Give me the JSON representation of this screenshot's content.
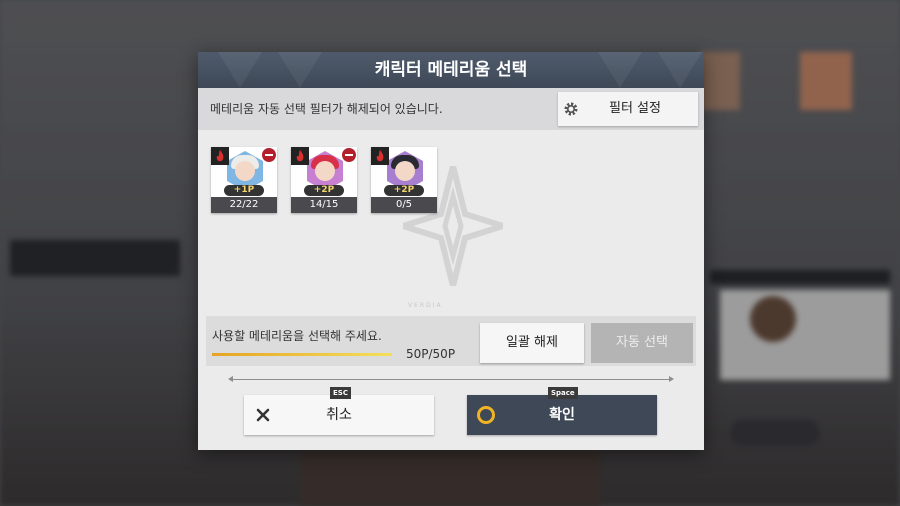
{
  "modal": {
    "title": "캐릭터 메테리움 선택",
    "filter_notice": "메테리움 자동 선택 필터가 해제되어 있습니다.",
    "filter_button": "필터 설정",
    "watermark_text": "VERDIA"
  },
  "cards": [
    {
      "bonus": "+1P",
      "count": "22/22",
      "hex_color": "#7fb6e4",
      "hair_color": "#ecece8"
    },
    {
      "bonus": "+2P",
      "count": "14/15",
      "hex_color": "#c77fd2",
      "hair_color": "#d9304a"
    },
    {
      "bonus": "+2P",
      "count": "0/5",
      "hex_color": "#a87fd0",
      "hair_color": "#2a2a33"
    }
  ],
  "selection": {
    "instruction": "사용할 메테리움을 선택해 주세요.",
    "points": "50P/50P",
    "progress_fraction": 1.0,
    "unselect_all_button": "일괄 해제",
    "auto_select_button": "자동 선택"
  },
  "actions": {
    "cancel_label": "취소",
    "cancel_key": "ESC",
    "confirm_label": "확인",
    "confirm_key": "Space"
  },
  "colors": {
    "header": "#4a5566",
    "confirm_button": "#3e4857",
    "accent_gold": "#f0b323",
    "remove_badge": "#b3202b"
  }
}
